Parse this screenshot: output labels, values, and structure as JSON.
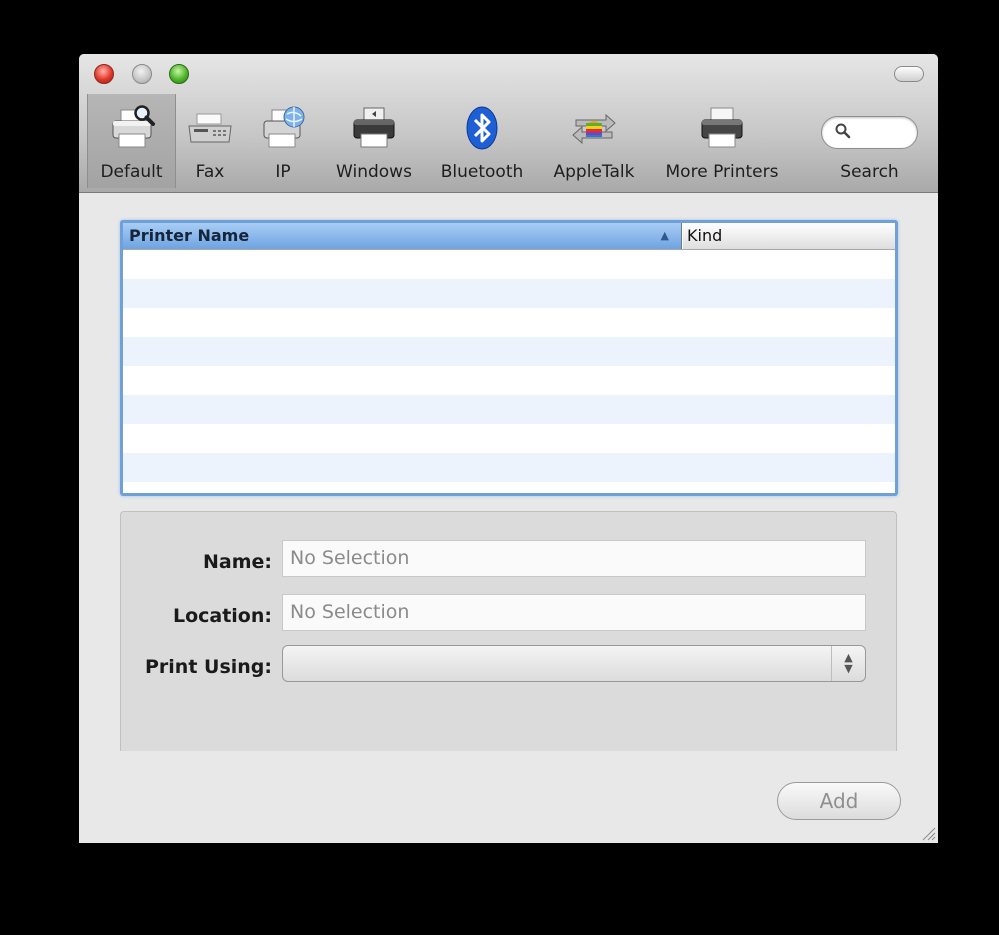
{
  "toolbar": {
    "items": [
      {
        "label": "Default",
        "icon": "default-printer-browser-icon",
        "selected": true
      },
      {
        "label": "Fax",
        "icon": "fax-icon",
        "selected": false
      },
      {
        "label": "IP",
        "icon": "ip-printer-icon",
        "selected": false
      },
      {
        "label": "Windows",
        "icon": "windows-printer-icon",
        "selected": false
      },
      {
        "label": "Bluetooth",
        "icon": "bluetooth-icon",
        "selected": false
      },
      {
        "label": "AppleTalk",
        "icon": "appletalk-icon",
        "selected": false
      },
      {
        "label": "More Printers",
        "icon": "more-printers-icon",
        "selected": false
      }
    ],
    "search": {
      "label": "Search",
      "placeholder": ""
    }
  },
  "printer_table": {
    "columns": [
      {
        "label": "Printer Name",
        "sorted": "ascending"
      },
      {
        "label": "Kind"
      }
    ],
    "rows": []
  },
  "details": {
    "name_label": "Name:",
    "name_value": "No Selection",
    "location_label": "Location:",
    "location_value": "No Selection",
    "print_using_label": "Print Using:",
    "print_using_value": ""
  },
  "buttons": {
    "add_label": "Add"
  },
  "colors": {
    "accent": "#6fa1d8",
    "row_stripe": "#edf3fd",
    "close": "#e0372a",
    "zoom": "#4db52a"
  }
}
